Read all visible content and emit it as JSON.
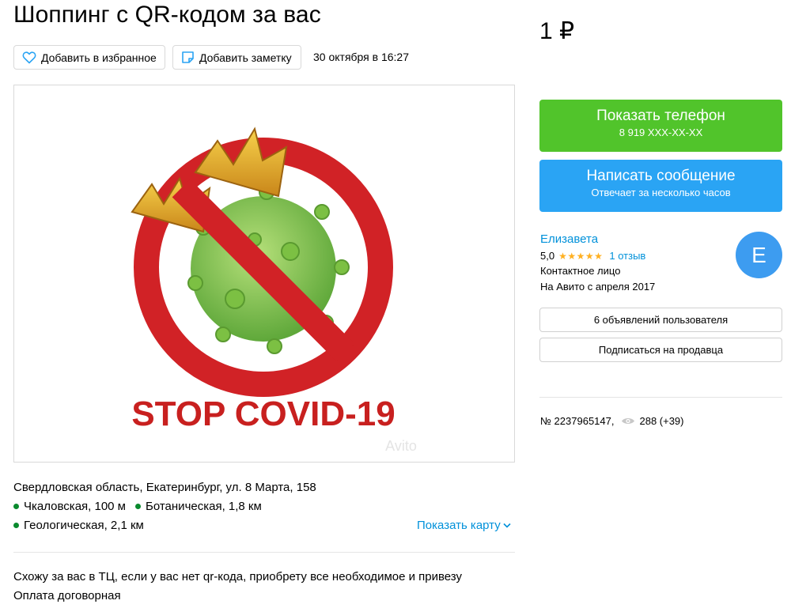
{
  "listing": {
    "title": "Шоппинг с QR-кодом за вас",
    "price": "1 ₽",
    "date": "30 октября в 16:27"
  },
  "actions": {
    "favorite_label": "Добавить в избранное",
    "note_label": "Добавить заметку"
  },
  "location": {
    "address": "Свердловская область, Екатеринбург, ул. 8 Марта, 158",
    "metro": [
      {
        "name": "Чкаловская, 100 м",
        "color": "#0a8a2e"
      },
      {
        "name": "Ботаническая, 1,8 км",
        "color": "#0a8a2e"
      },
      {
        "name": "Геологическая, 2,1 км",
        "color": "#0a8a2e"
      }
    ],
    "map_link": "Показать карту"
  },
  "description": {
    "lines": [
      "Схожу за вас в ТЦ, если у вас нет qr-кода, приобрету все необходимое и привезу",
      "Оплата договорная"
    ]
  },
  "photo": {
    "caption": "STOP COVID-19",
    "watermark": "Avito"
  },
  "contact": {
    "phone_button": "Показать телефон",
    "phone_number": "8 919 XXX-XX-XX",
    "message_button": "Написать сообщение",
    "message_sub": "Отвечает за несколько часов"
  },
  "seller": {
    "name": "Елизавета",
    "rating": "5,0",
    "stars": "★★★★★",
    "reviews": "1 отзыв",
    "type": "Контактное лицо",
    "since": "На Авито с апреля 2017",
    "avatar_letter": "E",
    "ads_button": "6 объявлений пользователя",
    "subscribe_button": "Подписаться на продавца"
  },
  "meta": {
    "ad_number": "№ 2237965147,",
    "views": "288 (+39)"
  },
  "colors": {
    "green_button": "#51c42b",
    "blue_button": "#2aa4f4",
    "link": "#0091da",
    "stars": "#ffb021",
    "metro_dot": "#0a8a2e"
  }
}
